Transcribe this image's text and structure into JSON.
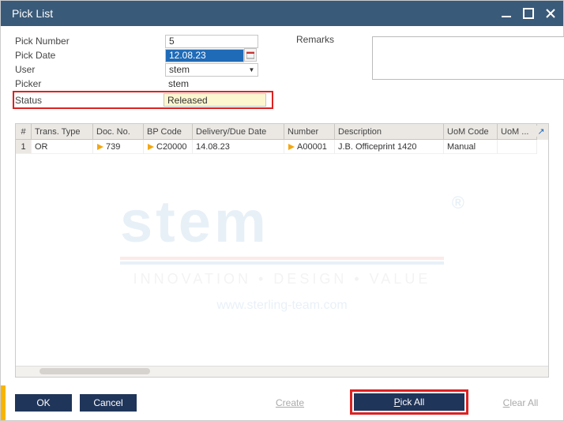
{
  "window": {
    "title": "Pick List"
  },
  "form": {
    "pick_number_label": "Pick Number",
    "pick_number": "5",
    "pick_date_label": "Pick Date",
    "pick_date": "12.08.23",
    "user_label": "User",
    "user": "stem",
    "picker_label": "Picker",
    "picker": "stem",
    "status_label": "Status",
    "status": "Released",
    "remarks_label": "Remarks",
    "remarks": ""
  },
  "grid": {
    "columns": {
      "num": "#",
      "trans_type": "Trans. Type",
      "doc_no": "Doc. No.",
      "bp_code": "BP Code",
      "delivery_date": "Delivery/Due Date",
      "number": "Number",
      "description": "Description",
      "uom_code": "UoM Code",
      "uom_name": "UoM ..."
    },
    "rows": [
      {
        "num": "1",
        "trans_type": "OR",
        "doc_no": "739",
        "bp_code": "C20000",
        "delivery_date": "14.08.23",
        "number": "A00001",
        "description": "J.B. Officeprint 1420",
        "uom_code": "Manual",
        "uom_name": ""
      }
    ]
  },
  "footer": {
    "ok": "OK",
    "cancel": "Cancel",
    "create": "Create",
    "pick_all": "Pick All",
    "clear_all": "Clear All"
  },
  "watermark": {
    "logo_text": "stem",
    "tagline": "INNOVATION  •  DESIGN  •  VALUE",
    "url": "www.sterling-team.com",
    "reg": "®"
  }
}
